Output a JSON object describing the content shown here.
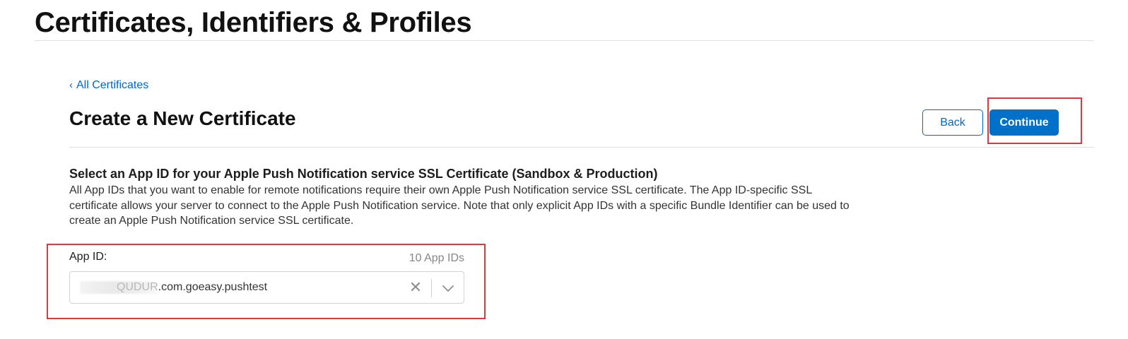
{
  "header": {
    "title": "Certificates, Identifiers & Profiles"
  },
  "nav": {
    "back_link_label": "All Certificates",
    "back_chevron": "‹"
  },
  "section": {
    "title": "Create a New Certificate",
    "back_button_label": "Back",
    "continue_button_label": "Continue"
  },
  "description": {
    "heading": "Select an App ID for your Apple Push Notification service SSL Certificate (Sandbox & Production)",
    "body": "All App IDs that you want to enable for remote notifications require their own Apple Push Notification service SSL certificate. The App ID-specific SSL certificate allows your server to connect to the Apple Push Notification service. Note that only explicit App IDs with a specific Bundle Identifier can be used to create an Apple Push Notification service SSL certificate."
  },
  "app_id_field": {
    "label": "App ID:",
    "count_label": "10 App IDs",
    "selected_value_prefix": "QUDUR",
    "selected_value": ".com.goeasy.pushtest",
    "clear_glyph": "✕"
  },
  "icons": {
    "clear": "close-icon",
    "dropdown": "chevron-down-icon",
    "back": "chevron-left-icon"
  },
  "colors": {
    "accent": "#0070c9",
    "link": "#0066cc",
    "highlight": "#e0383e"
  }
}
